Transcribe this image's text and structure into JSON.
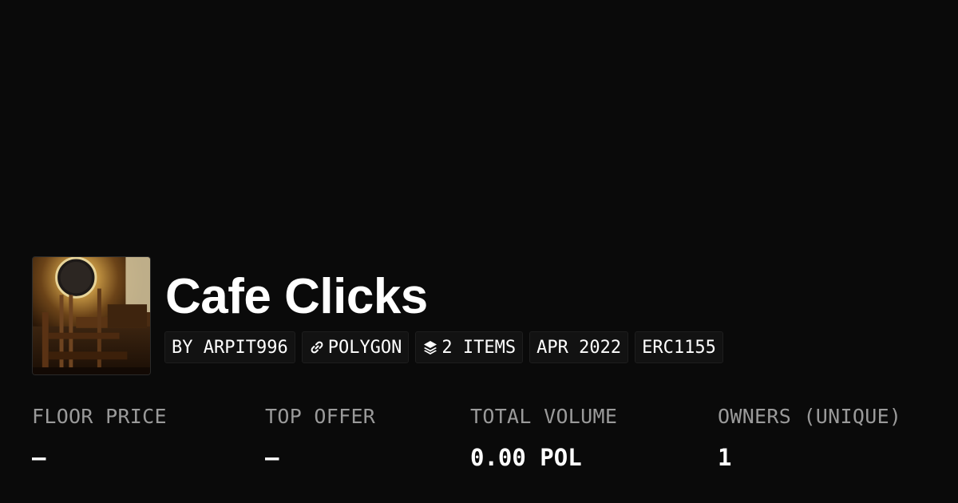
{
  "collection": {
    "title": "Cafe Clicks",
    "avatar_alt": "collection-image"
  },
  "tags": [
    {
      "label": "BY ARPIT996",
      "icon": null
    },
    {
      "label": "POLYGON",
      "icon": "link-chain-icon"
    },
    {
      "label": "2 ITEMS",
      "icon": "layers-icon"
    },
    {
      "label": "APR 2022",
      "icon": null
    },
    {
      "label": "ERC1155",
      "icon": null
    }
  ],
  "stats": [
    {
      "label": "FLOOR PRICE",
      "value": "–"
    },
    {
      "label": "TOP OFFER",
      "value": "–"
    },
    {
      "label": "TOTAL VOLUME",
      "value": "0.00 POL"
    },
    {
      "label": "OWNERS (UNIQUE)",
      "value": "1"
    }
  ],
  "colors": {
    "background": "#0a0a0a",
    "text": "#ffffff",
    "muted": "#9a9a9a",
    "tag_bg": "#121212"
  }
}
